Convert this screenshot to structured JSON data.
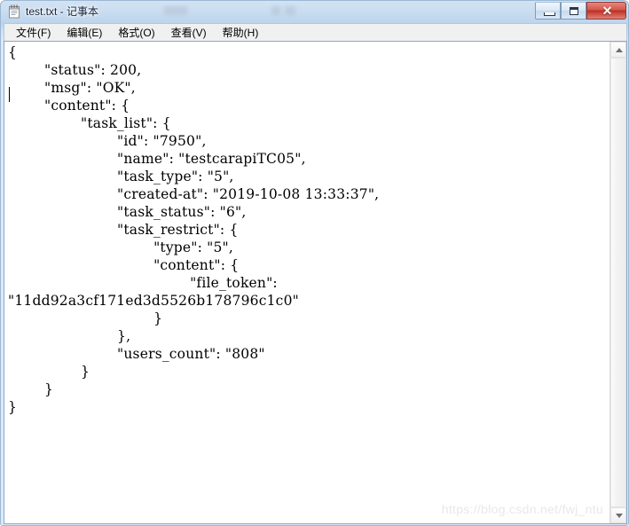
{
  "window": {
    "title": "test.txt - 记事本",
    "icon": "notepad-icon",
    "controls": {
      "minimize_label": "",
      "maximize_label": "",
      "close_label": "✕"
    }
  },
  "menubar": {
    "items": [
      {
        "label": "文件(F)",
        "name": "menu-file"
      },
      {
        "label": "编辑(E)",
        "name": "menu-edit"
      },
      {
        "label": "格式(O)",
        "name": "menu-format"
      },
      {
        "label": "查看(V)",
        "name": "menu-view"
      },
      {
        "label": "帮助(H)",
        "name": "menu-help"
      }
    ]
  },
  "editor": {
    "filename": "test.txt",
    "text": "{\n        \"status\": 200,\n        \"msg\": \"OK\",\n        \"content\": {\n                \"task_list\": {\n                        \"id\": \"7950\",\n                        \"name\": \"testcarapiTC05\",\n                        \"task_type\": \"5\",\n                        \"created-at\": \"2019-10-08 13:33:37\",\n                        \"task_status\": \"6\",\n                        \"task_restrict\": {\n                                \"type\": \"5\",\n                                \"content\": {\n                                        \"file_token\":\n\"11dd92a3cf171ed3d5526b178796c1c0\"\n                                }\n                        },\n                        \"users_count\": \"808\"\n                }\n        }\n}",
    "json_values": {
      "status": 200,
      "msg": "OK",
      "task_list_id": "7950",
      "task_list_name": "testcarapiTC05",
      "task_type": "5",
      "created_at": "2019-10-08 13:33:37",
      "task_status": "6",
      "task_restrict_type": "5",
      "file_token": "11dd92a3cf171ed3d5526b178796c1c0",
      "users_count": "808"
    }
  },
  "scrollbar": {
    "up_arrow": "triangle-up",
    "down_arrow": "triangle-down"
  },
  "watermark": {
    "text": "https://blog.csdn.net/fwj_ntu"
  }
}
